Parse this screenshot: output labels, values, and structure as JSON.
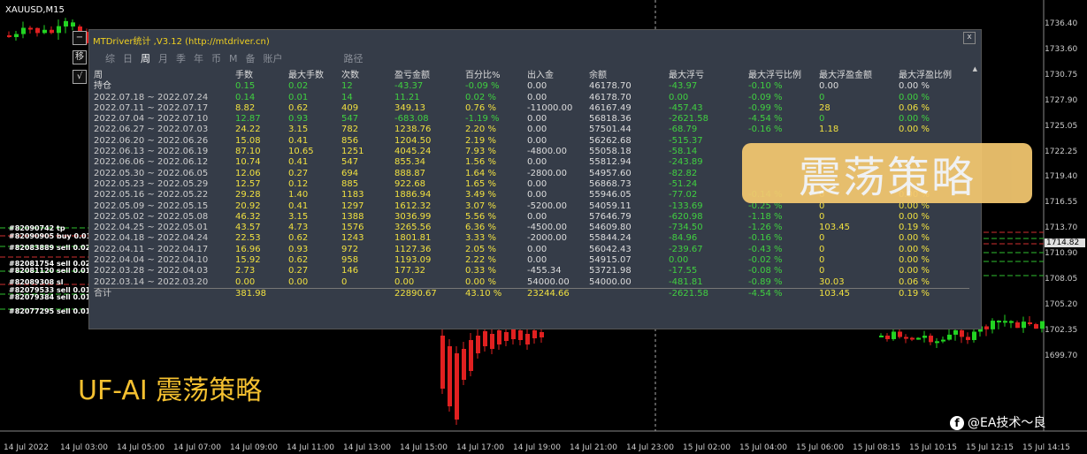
{
  "chart": {
    "symbol": "XAUUSD,M15",
    "current_price": "1714.82",
    "price_scale": [
      "1736.40",
      "1733.60",
      "1730.75",
      "1727.90",
      "1725.05",
      "1722.25",
      "1719.40",
      "1716.55",
      "1713.70",
      "1710.90",
      "1708.05",
      "1705.20",
      "1702.35",
      "1699.70"
    ],
    "time_labels": [
      "14 Jul 2022",
      "14 Jul 03:00",
      "14 Jul 05:00",
      "14 Jul 07:00",
      "14 Jul 09:00",
      "14 Jul 11:00",
      "14 Jul 13:00",
      "14 Jul 15:00",
      "14 Jul 17:00",
      "14 Jul 19:00",
      "14 Jul 21:00",
      "14 Jul 23:00",
      "15 Jul 02:00",
      "15 Jul 04:00",
      "15 Jul 06:00",
      "15 Jul 08:15",
      "15 Jul 10:15",
      "15 Jul 12:15",
      "15 Jul 14:15"
    ],
    "order_labels": [
      "#82090742 tp",
      "#82090905 buy 0.01",
      "#82083889 sell 0.02",
      "#82081754 sell 0.02",
      "#82081120 sell 0.01",
      "#82089308 sl",
      "#82079533 sell 0.01",
      "#82079384 sell 0.01",
      "#82077295 sell 0.01"
    ],
    "side_buttons": [
      "−",
      "移",
      "√"
    ]
  },
  "panel": {
    "title": "MTDriver统计 ,V3.12 (http://mtdriver.cn)",
    "close_label": "x",
    "tabs": [
      "综",
      "日",
      "周",
      "月",
      "季",
      "年",
      "币",
      "M",
      "备",
      "账户",
      "路径"
    ],
    "active_tab": "周",
    "headers": [
      "周",
      "手数",
      "最大手数",
      "次数",
      "盈亏金额",
      "百分比%",
      "出入金",
      "余额",
      "最大浮亏",
      "最大浮亏比例",
      "最大浮盈金额",
      "最大浮盈比例"
    ],
    "position_row": [
      "持仓",
      "0.15",
      "0.02",
      "12",
      "-43.37",
      "-0.09 %",
      "0.00",
      "46178.70",
      "-43.97",
      "-0.10 %",
      "0.00",
      "0.00 %"
    ],
    "rows": [
      [
        "2022.07.18 ~ 2022.07.24",
        "0.14",
        "0.01",
        "14",
        "11.21",
        "0.02 %",
        "0.00",
        "46178.70",
        "0.00",
        "-0.09 %",
        "0",
        "0.00 %"
      ],
      [
        "2022.07.11 ~ 2022.07.17",
        "8.82",
        "0.62",
        "409",
        "349.13",
        "0.76 %",
        "-11000.00",
        "46167.49",
        "-457.43",
        "-0.99 %",
        "28",
        "0.06 %"
      ],
      [
        "2022.07.04 ~ 2022.07.10",
        "12.87",
        "0.93",
        "547",
        "-683.08",
        "-1.19 %",
        "0.00",
        "56818.36",
        "-2621.58",
        "-4.54 %",
        "0",
        "0.00 %"
      ],
      [
        "2022.06.27 ~ 2022.07.03",
        "24.22",
        "3.15",
        "782",
        "1238.76",
        "2.20 %",
        "0.00",
        "57501.44",
        "-68.79",
        "-0.16 %",
        "1.18",
        "0.00 %"
      ],
      [
        "2022.06.20 ~ 2022.06.26",
        "15.08",
        "0.41",
        "856",
        "1204.50",
        "2.19 %",
        "0.00",
        "56262.68",
        "-515.37",
        "",
        "",
        ""
      ],
      [
        "2022.06.13 ~ 2022.06.19",
        "87.10",
        "10.65",
        "1251",
        "4045.24",
        "7.93 %",
        "-4800.00",
        "55058.18",
        "-58.14",
        "",
        "",
        ""
      ],
      [
        "2022.06.06 ~ 2022.06.12",
        "10.74",
        "0.41",
        "547",
        "855.34",
        "1.56 %",
        "0.00",
        "55812.94",
        "-243.89",
        "",
        "",
        ""
      ],
      [
        "2022.05.30 ~ 2022.06.05",
        "12.06",
        "0.27",
        "694",
        "888.87",
        "1.64 %",
        "-2800.00",
        "54957.60",
        "-82.82",
        "",
        "",
        ""
      ],
      [
        "2022.05.23 ~ 2022.05.29",
        "12.57",
        "0.12",
        "885",
        "922.68",
        "1.65 %",
        "0.00",
        "56868.73",
        "-51.24",
        "",
        "",
        ""
      ],
      [
        "2022.05.16 ~ 2022.05.22",
        "29.28",
        "1.40",
        "1183",
        "1886.94",
        "3.49 %",
        "0.00",
        "55946.05",
        "-77.02",
        "-0.14 %",
        "0",
        "0.00 %"
      ],
      [
        "2022.05.09 ~ 2022.05.15",
        "20.92",
        "0.41",
        "1297",
        "1612.32",
        "3.07 %",
        "-5200.00",
        "54059.11",
        "-133.69",
        "-0.25 %",
        "0",
        "0.00 %"
      ],
      [
        "2022.05.02 ~ 2022.05.08",
        "46.32",
        "3.15",
        "1388",
        "3036.99",
        "5.56 %",
        "0.00",
        "57646.79",
        "-620.98",
        "-1.18 %",
        "0",
        "0.00 %"
      ],
      [
        "2022.04.25 ~ 2022.05.01",
        "43.57",
        "4.73",
        "1576",
        "3265.56",
        "6.36 %",
        "-4500.00",
        "54609.80",
        "-734.50",
        "-1.26 %",
        "103.45",
        "0.19 %"
      ],
      [
        "2022.04.18 ~ 2022.04.24",
        "22.53",
        "0.62",
        "1243",
        "1801.81",
        "3.33 %",
        "-2000.00",
        "55844.24",
        "-84.96",
        "-0.16 %",
        "0",
        "0.00 %"
      ],
      [
        "2022.04.11 ~ 2022.04.17",
        "16.96",
        "0.93",
        "972",
        "1127.36",
        "2.05 %",
        "0.00",
        "56042.43",
        "-239.67",
        "-0.43 %",
        "0",
        "0.00 %"
      ],
      [
        "2022.04.04 ~ 2022.04.10",
        "15.92",
        "0.62",
        "958",
        "1193.09",
        "2.22 %",
        "0.00",
        "54915.07",
        "0.00",
        "-0.02 %",
        "0",
        "0.00 %"
      ],
      [
        "2022.03.28 ~ 2022.04.03",
        "2.73",
        "0.27",
        "146",
        "177.32",
        "0.33 %",
        "-455.34",
        "53721.98",
        "-17.55",
        "-0.08 %",
        "0",
        "0.00 %"
      ],
      [
        "2022.03.14 ~ 2022.03.20",
        "0.00",
        "0.00",
        "0",
        "0.00",
        "0.00 %",
        "54000.00",
        "54000.00",
        "-481.81",
        "-0.89 %",
        "30.03",
        "0.06 %"
      ]
    ],
    "total_row": [
      "合计",
      "381.98",
      "",
      "",
      "22890.67",
      "43.10 %",
      "23244.66",
      "",
      "-2621.58",
      "-4.54 %",
      "103.45",
      "0.19 %"
    ],
    "sort_arrow": "▲"
  },
  "overlays": {
    "banner_text": "震荡策略",
    "brand_text": "UF-AI   震荡策略",
    "watermark_text": "@EA技术～良",
    "watermark_icon": "f"
  }
}
